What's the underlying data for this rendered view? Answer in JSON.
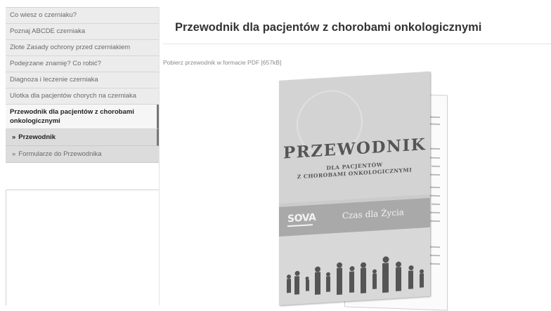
{
  "sidebar": {
    "items": [
      {
        "label": "Co wiesz o czerniaku?"
      },
      {
        "label": "Poznaj ABCDE czerniaka"
      },
      {
        "label": "Złote Zasady ochrony przed czerniakiem"
      },
      {
        "label": "Podejrzane znamię? Co robić?"
      },
      {
        "label": "Diagnoza i leczenie czerniaka"
      },
      {
        "label": "Ulotka dla pacjentów chorych na czerniaka"
      },
      {
        "label": "Przewodnik dla pacjentów z chorobami onkologicznymi"
      }
    ],
    "subitems": [
      {
        "label": "Przewodnik"
      },
      {
        "label": "Formularze do Przewodnika"
      }
    ],
    "sub_arrow": "»"
  },
  "main": {
    "title": "Przewodnik dla pacjentów z chorobami onkologicznymi",
    "download_prefix": "Pobierz",
    "download_link": "przewodnik",
    "download_suffix": "w formacie PDF [657kB]"
  },
  "booklet": {
    "title": "PRZEWODNIK",
    "subtitle_line1": "DLA PACJENTÓW",
    "subtitle_line2": "Z CHOROBAMI ONKOLOGICZNYMI",
    "logo_left": "SOVA",
    "logo_right": "Czas dla Życia"
  }
}
